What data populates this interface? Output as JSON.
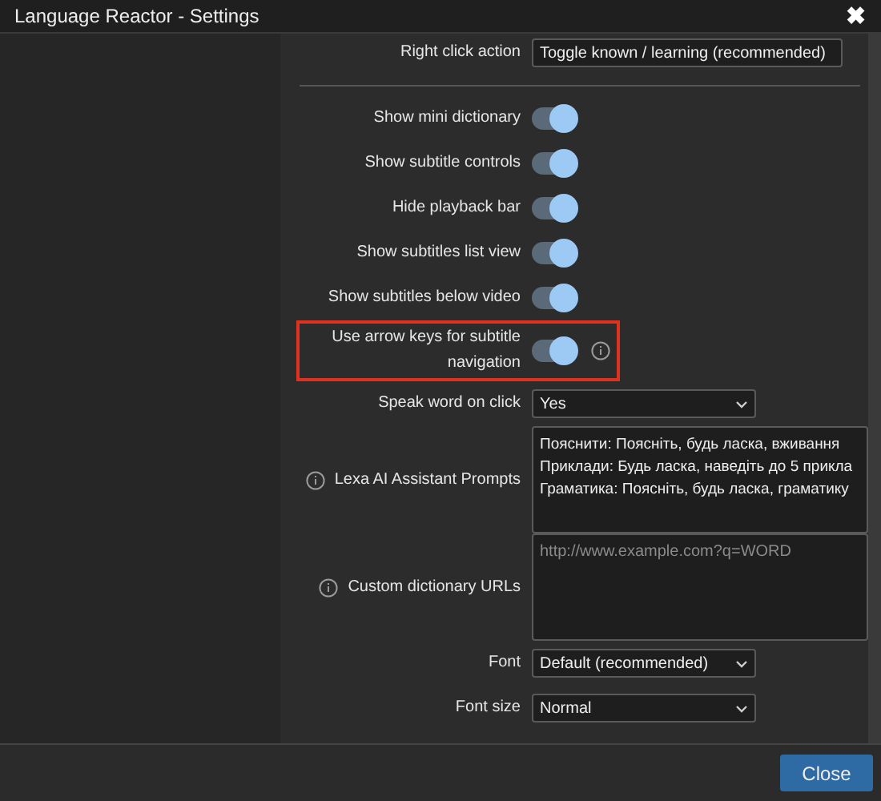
{
  "window": {
    "title": "Language Reactor - Settings",
    "close": "✖"
  },
  "settings": [
    {
      "kind": "select",
      "label": "Right click action",
      "value": "Toggle known / learning (recommended)",
      "wide": true
    },
    {
      "kind": "divider"
    },
    {
      "kind": "toggle",
      "label": "Show mini dictionary",
      "on": true
    },
    {
      "kind": "toggle",
      "label": "Show subtitle controls",
      "on": true
    },
    {
      "kind": "toggle",
      "label": "Hide playback bar",
      "on": true
    },
    {
      "kind": "toggle",
      "label": "Show subtitles list view",
      "on": true
    },
    {
      "kind": "toggle",
      "label": "Show subtitles below video",
      "on": true
    },
    {
      "kind": "toggle",
      "label": "Use arrow keys for subtitle navigation",
      "on": true,
      "info_right": true,
      "highlighted": true
    },
    {
      "kind": "select",
      "label": "Speak word on click",
      "value": "Yes"
    },
    {
      "kind": "textarea",
      "label": "Lexa AI Assistant Prompts",
      "info_left": true,
      "lines": [
        "Пояснити: Поясніть, будь ласка, вживання",
        "Приклади: Будь ласка, наведіть до 5 прикла",
        "Граматика: Поясніть, будь ласка, граматику"
      ]
    },
    {
      "kind": "textarea",
      "label": "Custom dictionary URLs",
      "info_left": true,
      "placeholder": "http://www.example.com?q=WORD"
    },
    {
      "kind": "select",
      "label": "Font",
      "value": "Default (recommended)"
    },
    {
      "kind": "select",
      "label": "Font size",
      "value": "Normal"
    }
  ],
  "footer": {
    "button": "Close"
  }
}
